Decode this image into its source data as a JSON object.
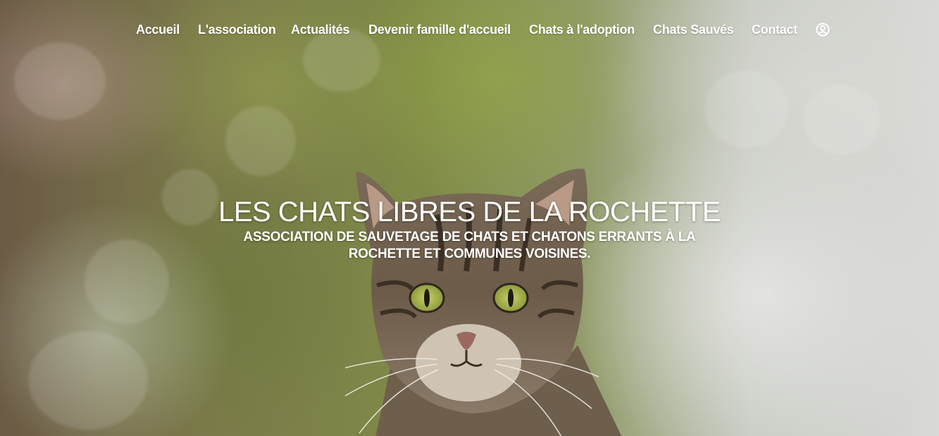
{
  "nav": {
    "items": [
      {
        "label": "Accueil"
      },
      {
        "label": "L'association"
      },
      {
        "label": "Actualités"
      },
      {
        "label": "Devenir famille d'accueil"
      },
      {
        "label": "Chats à l'adoption"
      },
      {
        "label": "Chats Sauvés"
      },
      {
        "label": "Contact"
      }
    ],
    "account_icon": "user-circle-icon"
  },
  "hero": {
    "title": "LES CHATS LIBRES DE LA ROCHETTE",
    "subtitle": "ASSOCIATION DE SAUVETAGE DE CHATS ET CHATONS ERRANTS À LA ROCHETTE ET COMMUNES VOISINES.",
    "background_image": "tabby-cat-photo"
  },
  "colors": {
    "nav_text": "#ffffff",
    "title_text": "#ffffff"
  }
}
